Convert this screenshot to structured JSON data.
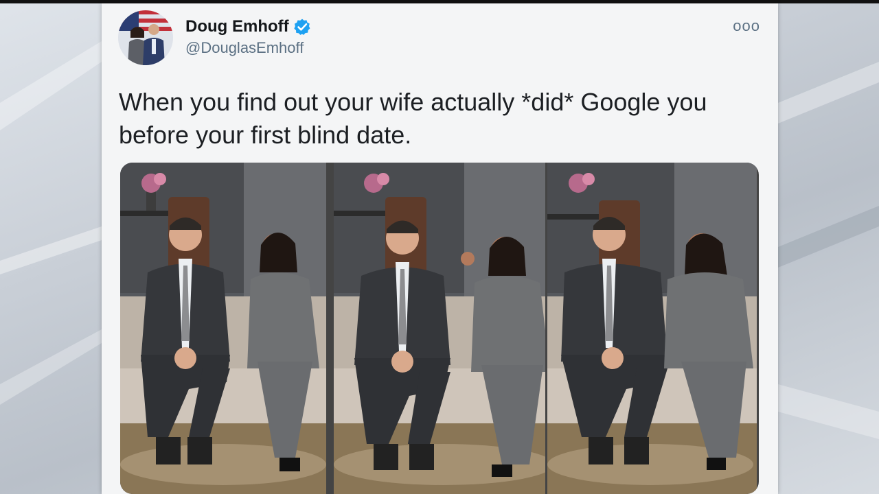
{
  "tweet": {
    "author_name": "Doug Emhoff",
    "verified_icon": "verified-badge-icon",
    "handle": "@DouglasEmhoff",
    "more_icon": "more-horizontal-icon",
    "more_label": "ooo",
    "text": "When you find out your wife actually *did* Google you before your first blind date.",
    "media_count": 3
  },
  "colors": {
    "verified": "#1da1f2",
    "name": "#14171a",
    "handle": "#5b7083",
    "card_bg": "#f4f5f6"
  }
}
